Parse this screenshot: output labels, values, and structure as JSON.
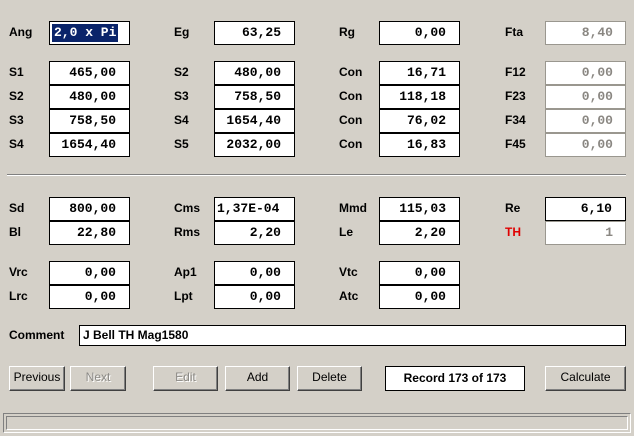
{
  "rows1": [
    {
      "label": "Ang",
      "value": "2,0 x Pi"
    },
    {
      "label": "Eg",
      "value": "63,25"
    },
    {
      "label": "Rg",
      "value": "0,00"
    },
    {
      "label": "Fta",
      "value": "8,40"
    }
  ],
  "grid": {
    "col1": [
      {
        "label": "S1",
        "value": "465,00"
      },
      {
        "label": "S2",
        "value": "480,00"
      },
      {
        "label": "S3",
        "value": "758,50"
      },
      {
        "label": "S4",
        "value": "1654,40"
      }
    ],
    "col2": [
      {
        "label": "S2",
        "value": "480,00"
      },
      {
        "label": "S3",
        "value": "758,50"
      },
      {
        "label": "S4",
        "value": "1654,40"
      },
      {
        "label": "S5",
        "value": "2032,00"
      }
    ],
    "col3": [
      {
        "label": "Con",
        "value": "16,71"
      },
      {
        "label": "Con",
        "value": "118,18"
      },
      {
        "label": "Con",
        "value": "76,02"
      },
      {
        "label": "Con",
        "value": "16,83"
      }
    ],
    "col4": [
      {
        "label": "F12",
        "value": "0,00"
      },
      {
        "label": "F23",
        "value": "0,00"
      },
      {
        "label": "F34",
        "value": "0,00"
      },
      {
        "label": "F45",
        "value": "0,00"
      }
    ]
  },
  "lower": {
    "sd": {
      "label": "Sd",
      "value": "800,00"
    },
    "cms": {
      "label": "Cms",
      "value": "1,37E-04"
    },
    "mmd": {
      "label": "Mmd",
      "value": "115,03"
    },
    "re": {
      "label": "Re",
      "value": "6,10"
    },
    "bl": {
      "label": "Bl",
      "value": "22,80"
    },
    "rms": {
      "label": "Rms",
      "value": "2,20"
    },
    "le": {
      "label": "Le",
      "value": "2,20"
    },
    "th": {
      "label": "TH",
      "value": "1"
    },
    "vrc": {
      "label": "Vrc",
      "value": "0,00"
    },
    "ap1": {
      "label": "Ap1",
      "value": "0,00"
    },
    "vtc": {
      "label": "Vtc",
      "value": "0,00"
    },
    "lrc": {
      "label": "Lrc",
      "value": "0,00"
    },
    "lpt": {
      "label": "Lpt",
      "value": "0,00"
    },
    "atc": {
      "label": "Atc",
      "value": "0,00"
    }
  },
  "comment": {
    "label": "Comment",
    "value": "J Bell TH Mag1580"
  },
  "buttons": {
    "previous": "Previous",
    "next": "Next",
    "edit": "Edit",
    "add": "Add",
    "delete": "Delete",
    "calculate": "Calculate"
  },
  "record": "Record 173 of 173",
  "colors": {
    "th_label": "#e00000",
    "selection": "#0a246a"
  }
}
